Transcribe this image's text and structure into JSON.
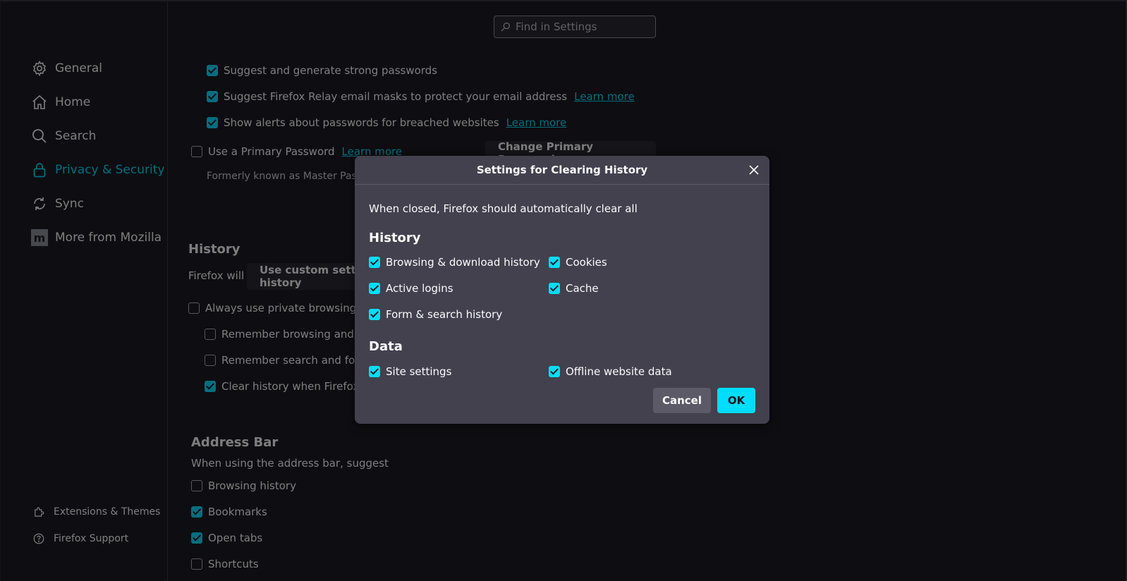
{
  "search": {
    "placeholder": "Find in Settings"
  },
  "sidebar": {
    "items": [
      {
        "label": "General",
        "icon": "gear-icon"
      },
      {
        "label": "Home",
        "icon": "home-icon"
      },
      {
        "label": "Search",
        "icon": "search-icon"
      },
      {
        "label": "Privacy & Security",
        "icon": "lock-icon",
        "active": true
      },
      {
        "label": "Sync",
        "icon": "sync-icon"
      },
      {
        "label": "More from Mozilla",
        "icon": "mozilla-icon"
      }
    ],
    "footer": [
      {
        "label": "Extensions & Themes",
        "icon": "puzzle-icon"
      },
      {
        "label": "Firefox Support",
        "icon": "help-icon"
      }
    ]
  },
  "passwords": {
    "suggest_strong": "Suggest and generate strong passwords",
    "suggest_relay": "Suggest Firefox Relay email masks to protect your email address",
    "show_alerts": "Show alerts about passwords for breached websites",
    "learn_more": "Learn more",
    "primary_password": "Use a Primary Password",
    "change_primary": "Change Primary Password…",
    "formerly": "Formerly known as Master Password"
  },
  "history": {
    "heading": "History",
    "firefox_will": "Firefox will",
    "mode": "Use custom settings for history",
    "always_private": "Always use private browsing mode",
    "remember_browsing": "Remember browsing and download history",
    "remember_search": "Remember search and form history",
    "clear_on_close": "Clear history when Firefox closes"
  },
  "address_bar": {
    "heading": "Address Bar",
    "subtitle": "When using the address bar, suggest",
    "browsing_history": "Browsing history",
    "bookmarks": "Bookmarks",
    "open_tabs": "Open tabs",
    "shortcuts": "Shortcuts"
  },
  "dialog": {
    "title": "Settings for Clearing History",
    "intro": "When closed, Firefox should automatically clear all",
    "history_heading": "History",
    "browsing_download": "Browsing & download history",
    "cookies": "Cookies",
    "active_logins": "Active logins",
    "cache": "Cache",
    "form_search": "Form & search history",
    "data_heading": "Data",
    "site_settings": "Site settings",
    "offline_data": "Offline website data",
    "cancel": "Cancel",
    "ok": "OK"
  },
  "colors": {
    "accent": "#00ddff",
    "background": "#1c1b22",
    "dialog": "#42414d"
  }
}
